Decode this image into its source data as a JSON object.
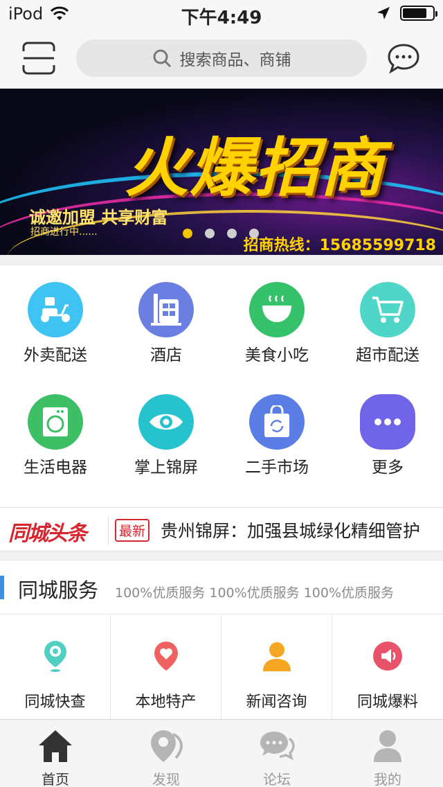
{
  "status_bar": {
    "carrier": "iPod",
    "time": "下午4:49"
  },
  "header": {
    "search_placeholder": "搜索商品、商铺"
  },
  "banner": {
    "title": "火爆招商",
    "slogan": "诚邀加盟 共享财富",
    "subtext": "招商进行中......",
    "hotline": "招商热线：15685599718",
    "slides": 4,
    "active_slide": 1
  },
  "grid": [
    {
      "label": "外卖配送",
      "icon": "scooter-icon",
      "color": "#3ec3f3"
    },
    {
      "label": "酒店",
      "icon": "hotel-icon",
      "color": "#6b7fe3"
    },
    {
      "label": "美食小吃",
      "icon": "bowl-icon",
      "color": "#36c26a"
    },
    {
      "label": "超市配送",
      "icon": "cart-icon",
      "color": "#4fd6c8"
    },
    {
      "label": "生活电器",
      "icon": "washer-icon",
      "color": "#3dbf66"
    },
    {
      "label": "掌上锦屏",
      "icon": "eye-icon",
      "color": "#26c3cf"
    },
    {
      "label": "二手市场",
      "icon": "bag-icon",
      "color": "#5b7de6"
    },
    {
      "label": "更多",
      "icon": "more-icon",
      "color": "#7065e8"
    }
  ],
  "news": {
    "logo": "同城头条",
    "tag": "最新",
    "headline": "贵州锦屏：加强县城绿化精细管护"
  },
  "service": {
    "title": "同城服务",
    "subtitle": "100%优质服务 100%优质服务 100%优质服务",
    "items": [
      {
        "label": "同城快查",
        "icon": "location-pin-icon",
        "color": "#4fd0c0"
      },
      {
        "label": "本地特产",
        "icon": "heart-pin-icon",
        "color": "#f06262"
      },
      {
        "label": "新闻咨询",
        "icon": "user-icon",
        "color": "#f5a623"
      },
      {
        "label": "同城爆料",
        "icon": "megaphone-icon",
        "color": "#e8536a"
      }
    ]
  },
  "tabbar": [
    {
      "label": "首页",
      "icon": "home-icon",
      "active": true
    },
    {
      "label": "发现",
      "icon": "discover-icon",
      "active": false
    },
    {
      "label": "论坛",
      "icon": "forum-icon",
      "active": false
    },
    {
      "label": "我的",
      "icon": "profile-icon",
      "active": false
    }
  ]
}
